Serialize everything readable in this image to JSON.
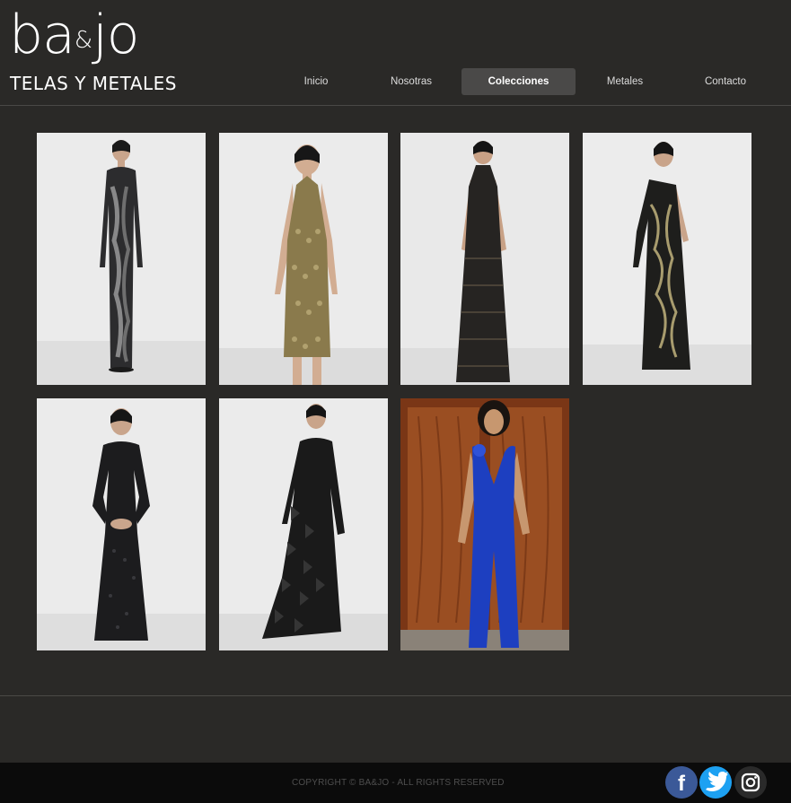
{
  "brand": {
    "word_a": "ba",
    "amp": "&",
    "word_b": "jo",
    "tagline": "TELAS Y METALES"
  },
  "nav": {
    "items": [
      {
        "label": "Inicio"
      },
      {
        "label": "Nosotras"
      },
      {
        "label": "Colecciones"
      },
      {
        "label": "Metales"
      },
      {
        "label": "Contacto"
      }
    ],
    "active_index": 2
  },
  "gallery": {
    "items": [
      {
        "dress": "long black and silver sequined gown, long sleeves",
        "color": "#2c2c2e",
        "accent": "#9a9a9a",
        "background": "#ebebeb"
      },
      {
        "dress": "short gold sequined halter dress",
        "color": "#8a7a4c",
        "accent": "#c2b27e",
        "background": "#ebebeb"
      },
      {
        "dress": "long black sequined halter gown",
        "color": "#262422",
        "accent": "#5a5040",
        "background": "#ebebeb"
      },
      {
        "dress": "long black one-shoulder gown with gold pattern",
        "color": "#1e1e1c",
        "accent": "#a89c6e",
        "background": "#ebebeb"
      },
      {
        "dress": "long black sequined gown, long sleeves",
        "color": "#1c1c1e",
        "accent": "#3c3c40",
        "background": "#ebebeb"
      },
      {
        "dress": "long black ruffled gown",
        "color": "#1a1a1a",
        "accent": "#353535",
        "background": "#ebebeb"
      },
      {
        "dress": "royal blue jumpsuit in front of wooden door",
        "color": "#1d3fc0",
        "accent": "#2f52d8",
        "background": "#8a3f1a"
      }
    ]
  },
  "footer": {
    "copyright": "COPYRIGHT © BA&JO - ALL RIGHTS RESERVED"
  },
  "social": [
    {
      "icon": "facebook-icon",
      "glyph": "f",
      "color": "#3b5998"
    },
    {
      "icon": "twitter-icon",
      "color": "#1da1f2"
    },
    {
      "icon": "instagram-icon",
      "color": "#2a2a2a"
    }
  ]
}
